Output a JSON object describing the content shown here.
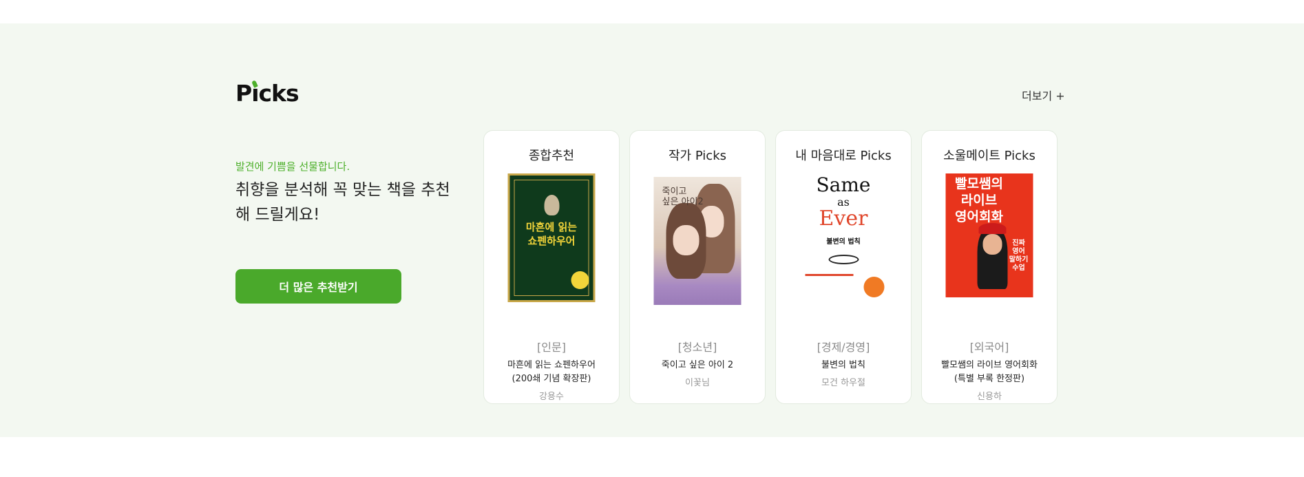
{
  "section": {
    "logo_text": "Picks",
    "more_link": "더보기 +",
    "eyebrow": "발견에 기쁨을 선물합니다.",
    "headline": "취향을 분석해 꼭 맞는 책을 추천해 드릴게요!",
    "cta_label": "더 많은 추천받기"
  },
  "cards": [
    {
      "title": "종합추천",
      "cover_text": [
        "마흔에 읽는",
        "쇼펜하우어"
      ],
      "genre": "[인문]",
      "book_title": "마흔에 읽는 쇼펜하우어 (200쇄 기념 확장판)",
      "author": "강용수"
    },
    {
      "title": "작가 Picks",
      "cover_text": [
        "죽이고",
        "싶은 아이2"
      ],
      "genre": "[청소년]",
      "book_title": "죽이고 싶은 아이 2",
      "author": "이꽃님"
    },
    {
      "title": "내 마음대로 Picks",
      "cover_text": [
        "Same",
        "as",
        "Ever",
        "불변의 법칙"
      ],
      "genre": "[경제/경영]",
      "book_title": "불변의 법칙",
      "author": "모건 하우절"
    },
    {
      "title": "소울메이트 Picks",
      "cover_text": [
        "빨모쌤의",
        "라이브",
        "영어회화",
        "진짜 영어 말하기 수업"
      ],
      "genre": "[외국어]",
      "book_title": "빨모쌤의 라이브 영어회화 (특별 부록 한정판)",
      "author": "신용하"
    }
  ],
  "colors": {
    "accent": "#4aa92b",
    "band_bg": "#f3f8f1"
  }
}
